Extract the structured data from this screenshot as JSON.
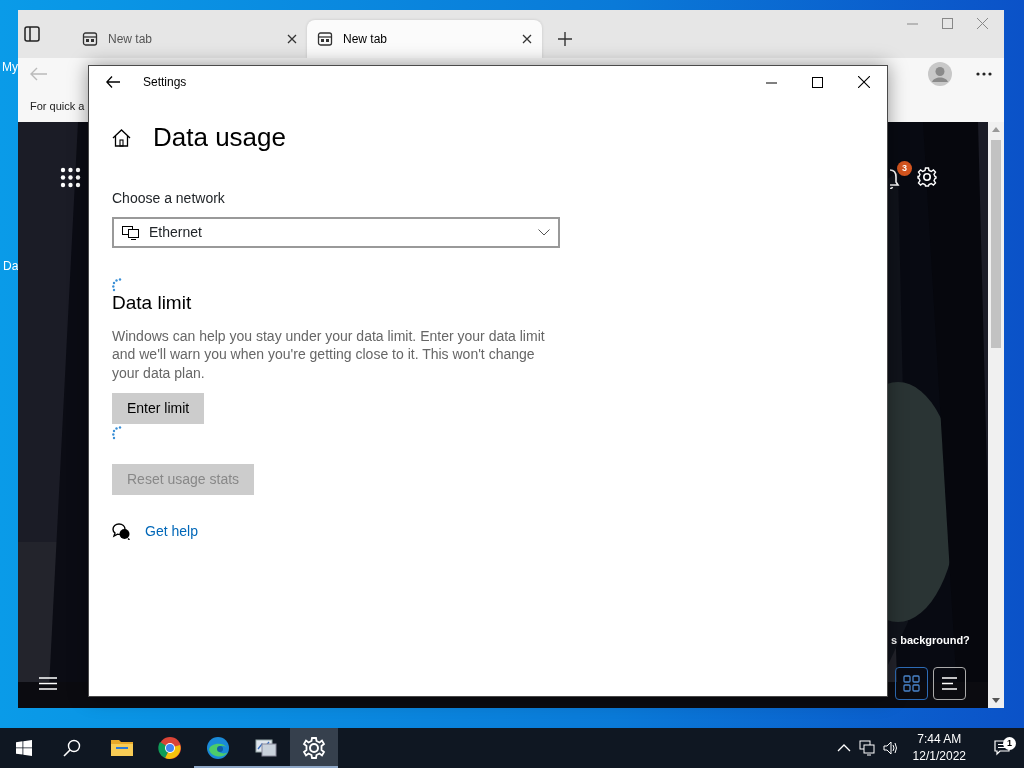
{
  "desktop": {
    "icon_labels": [
      "My",
      "Da"
    ]
  },
  "browser": {
    "tabs": [
      {
        "label": "New tab",
        "selected": false
      },
      {
        "label": "New tab",
        "selected": true
      }
    ],
    "bookmarks_text": "For quick a",
    "page": {
      "notification_count": "3",
      "background_prompt": "s background?",
      "layout_options": [
        {
          "kind": "grid",
          "selected": true
        },
        {
          "kind": "list",
          "selected": false
        }
      ]
    }
  },
  "settings": {
    "window_title": "Settings",
    "heading": "Data usage",
    "network_label": "Choose a network",
    "network": "Ethernet",
    "section_title": "Data limit",
    "description": "Windows can help you stay under your data limit. Enter your data limit and we'll warn you when you're getting close to it. This won't change your data plan.",
    "buttons": [
      {
        "label": "Enter limit",
        "disabled": false,
        "loading_after": true
      },
      {
        "label": "Reset usage stats",
        "disabled": true,
        "loading_after": false
      }
    ],
    "help_link": "Get help"
  },
  "taskbar": {
    "apps": [
      {
        "kind": "explorer",
        "running": false,
        "selected": false
      },
      {
        "kind": "chrome",
        "running": false,
        "selected": false
      },
      {
        "kind": "edge",
        "running": true,
        "selected": false
      },
      {
        "kind": "monitor",
        "running": true,
        "selected": false
      },
      {
        "kind": "settings",
        "running": true,
        "selected": true
      }
    ],
    "time": "7:44 AM",
    "date": "12/1/2022",
    "notification_count": "1"
  }
}
